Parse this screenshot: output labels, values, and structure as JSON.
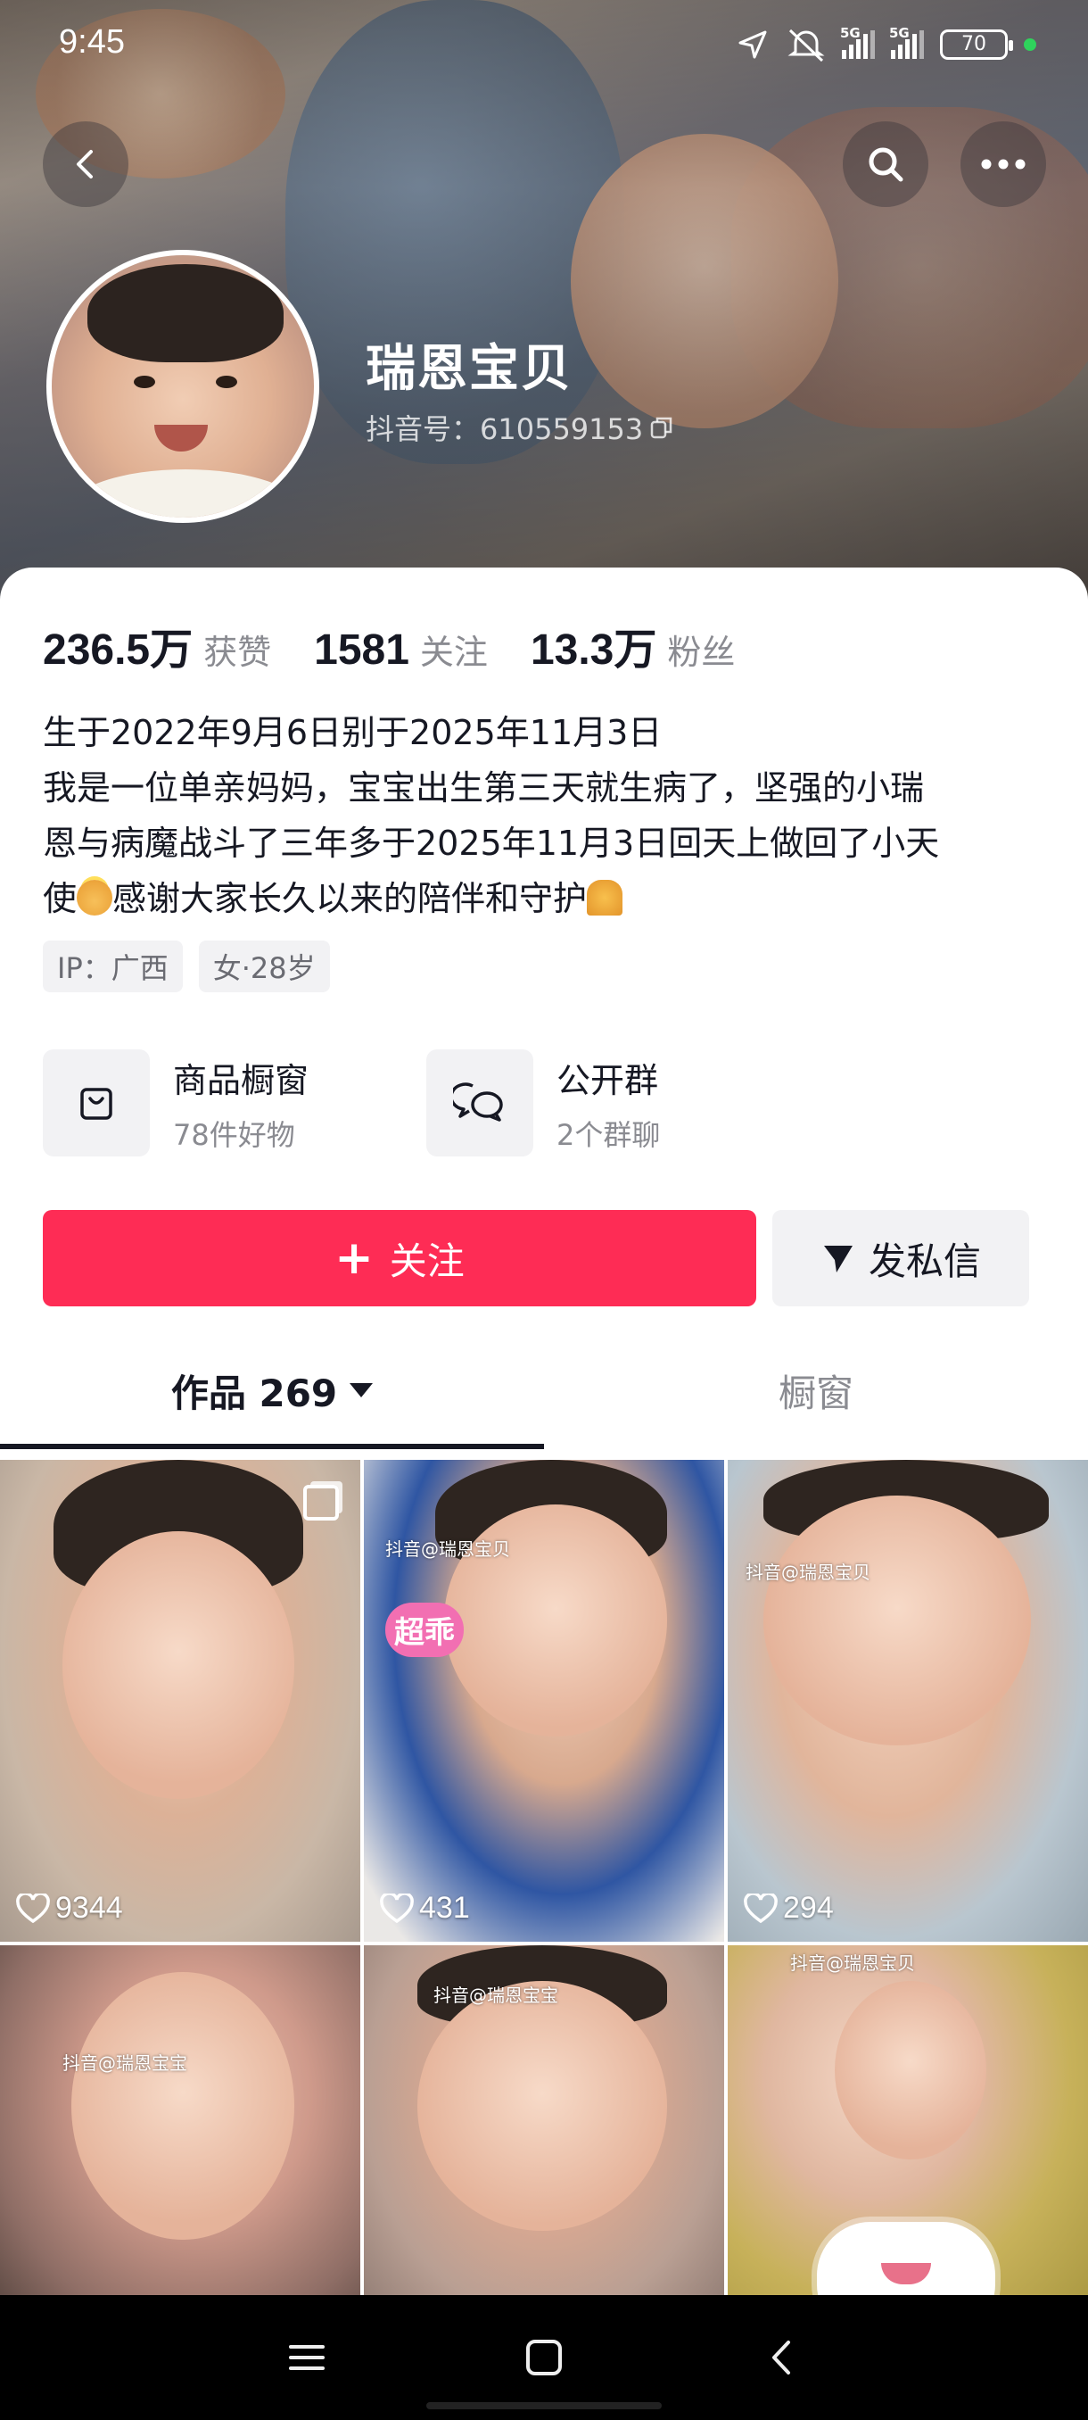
{
  "status_bar": {
    "time": "9:45",
    "network1": "5G",
    "network2": "5G",
    "battery": "70"
  },
  "header": {
    "nickname": "瑞恩宝贝",
    "douyin_id": "抖音号：610559153"
  },
  "stats": [
    {
      "value": "236.5万",
      "label": "获赞"
    },
    {
      "value": "1581",
      "label": "关注"
    },
    {
      "value": "13.3万",
      "label": "粉丝"
    }
  ],
  "bio": {
    "line1": "生于2022年9月6日别于2025年11月3日",
    "line2": "我是一位单亲妈妈，宝宝出生第三天就生病了，坚强的小瑞",
    "line3": "恩与病魔战斗了三年多于2025年11月3日回天上做回了小天",
    "line4_a": "使",
    "line4_b": "感谢大家长久以来的陪伴和守护"
  },
  "tags": {
    "ip": "IP：广西",
    "gender_age": "女·28岁"
  },
  "features": {
    "shop": {
      "title": "商品橱窗",
      "sub": "78件好物"
    },
    "group": {
      "title": "公开群",
      "sub": "2个群聊"
    }
  },
  "actions": {
    "follow": "关注",
    "message": "发私信"
  },
  "tabs": {
    "works": "作品 269",
    "shop": "橱窗"
  },
  "videos": [
    {
      "likes": "9344",
      "watermark": ""
    },
    {
      "likes": "431",
      "watermark": "抖音@瑞恩宝贝",
      "sticker": "超乖"
    },
    {
      "likes": "294",
      "watermark": "抖音@瑞恩宝贝"
    },
    {
      "likes": "",
      "watermark": "抖音@瑞恩宝宝"
    },
    {
      "likes": "",
      "watermark": "抖音@瑞恩宝宝"
    },
    {
      "likes": "",
      "watermark": "抖音@瑞恩宝贝"
    }
  ],
  "colors": {
    "accent": "#fe2c55",
    "text_primary": "#161823",
    "text_secondary": "#8a8b91"
  },
  "icons": {
    "back": "chevron-left-icon",
    "search": "search-icon",
    "more": "more-dots-icon",
    "copy": "copy-icon",
    "shop": "shopping-bag-icon",
    "group": "chat-bubbles-icon",
    "send": "send-icon",
    "like": "heart-icon"
  }
}
